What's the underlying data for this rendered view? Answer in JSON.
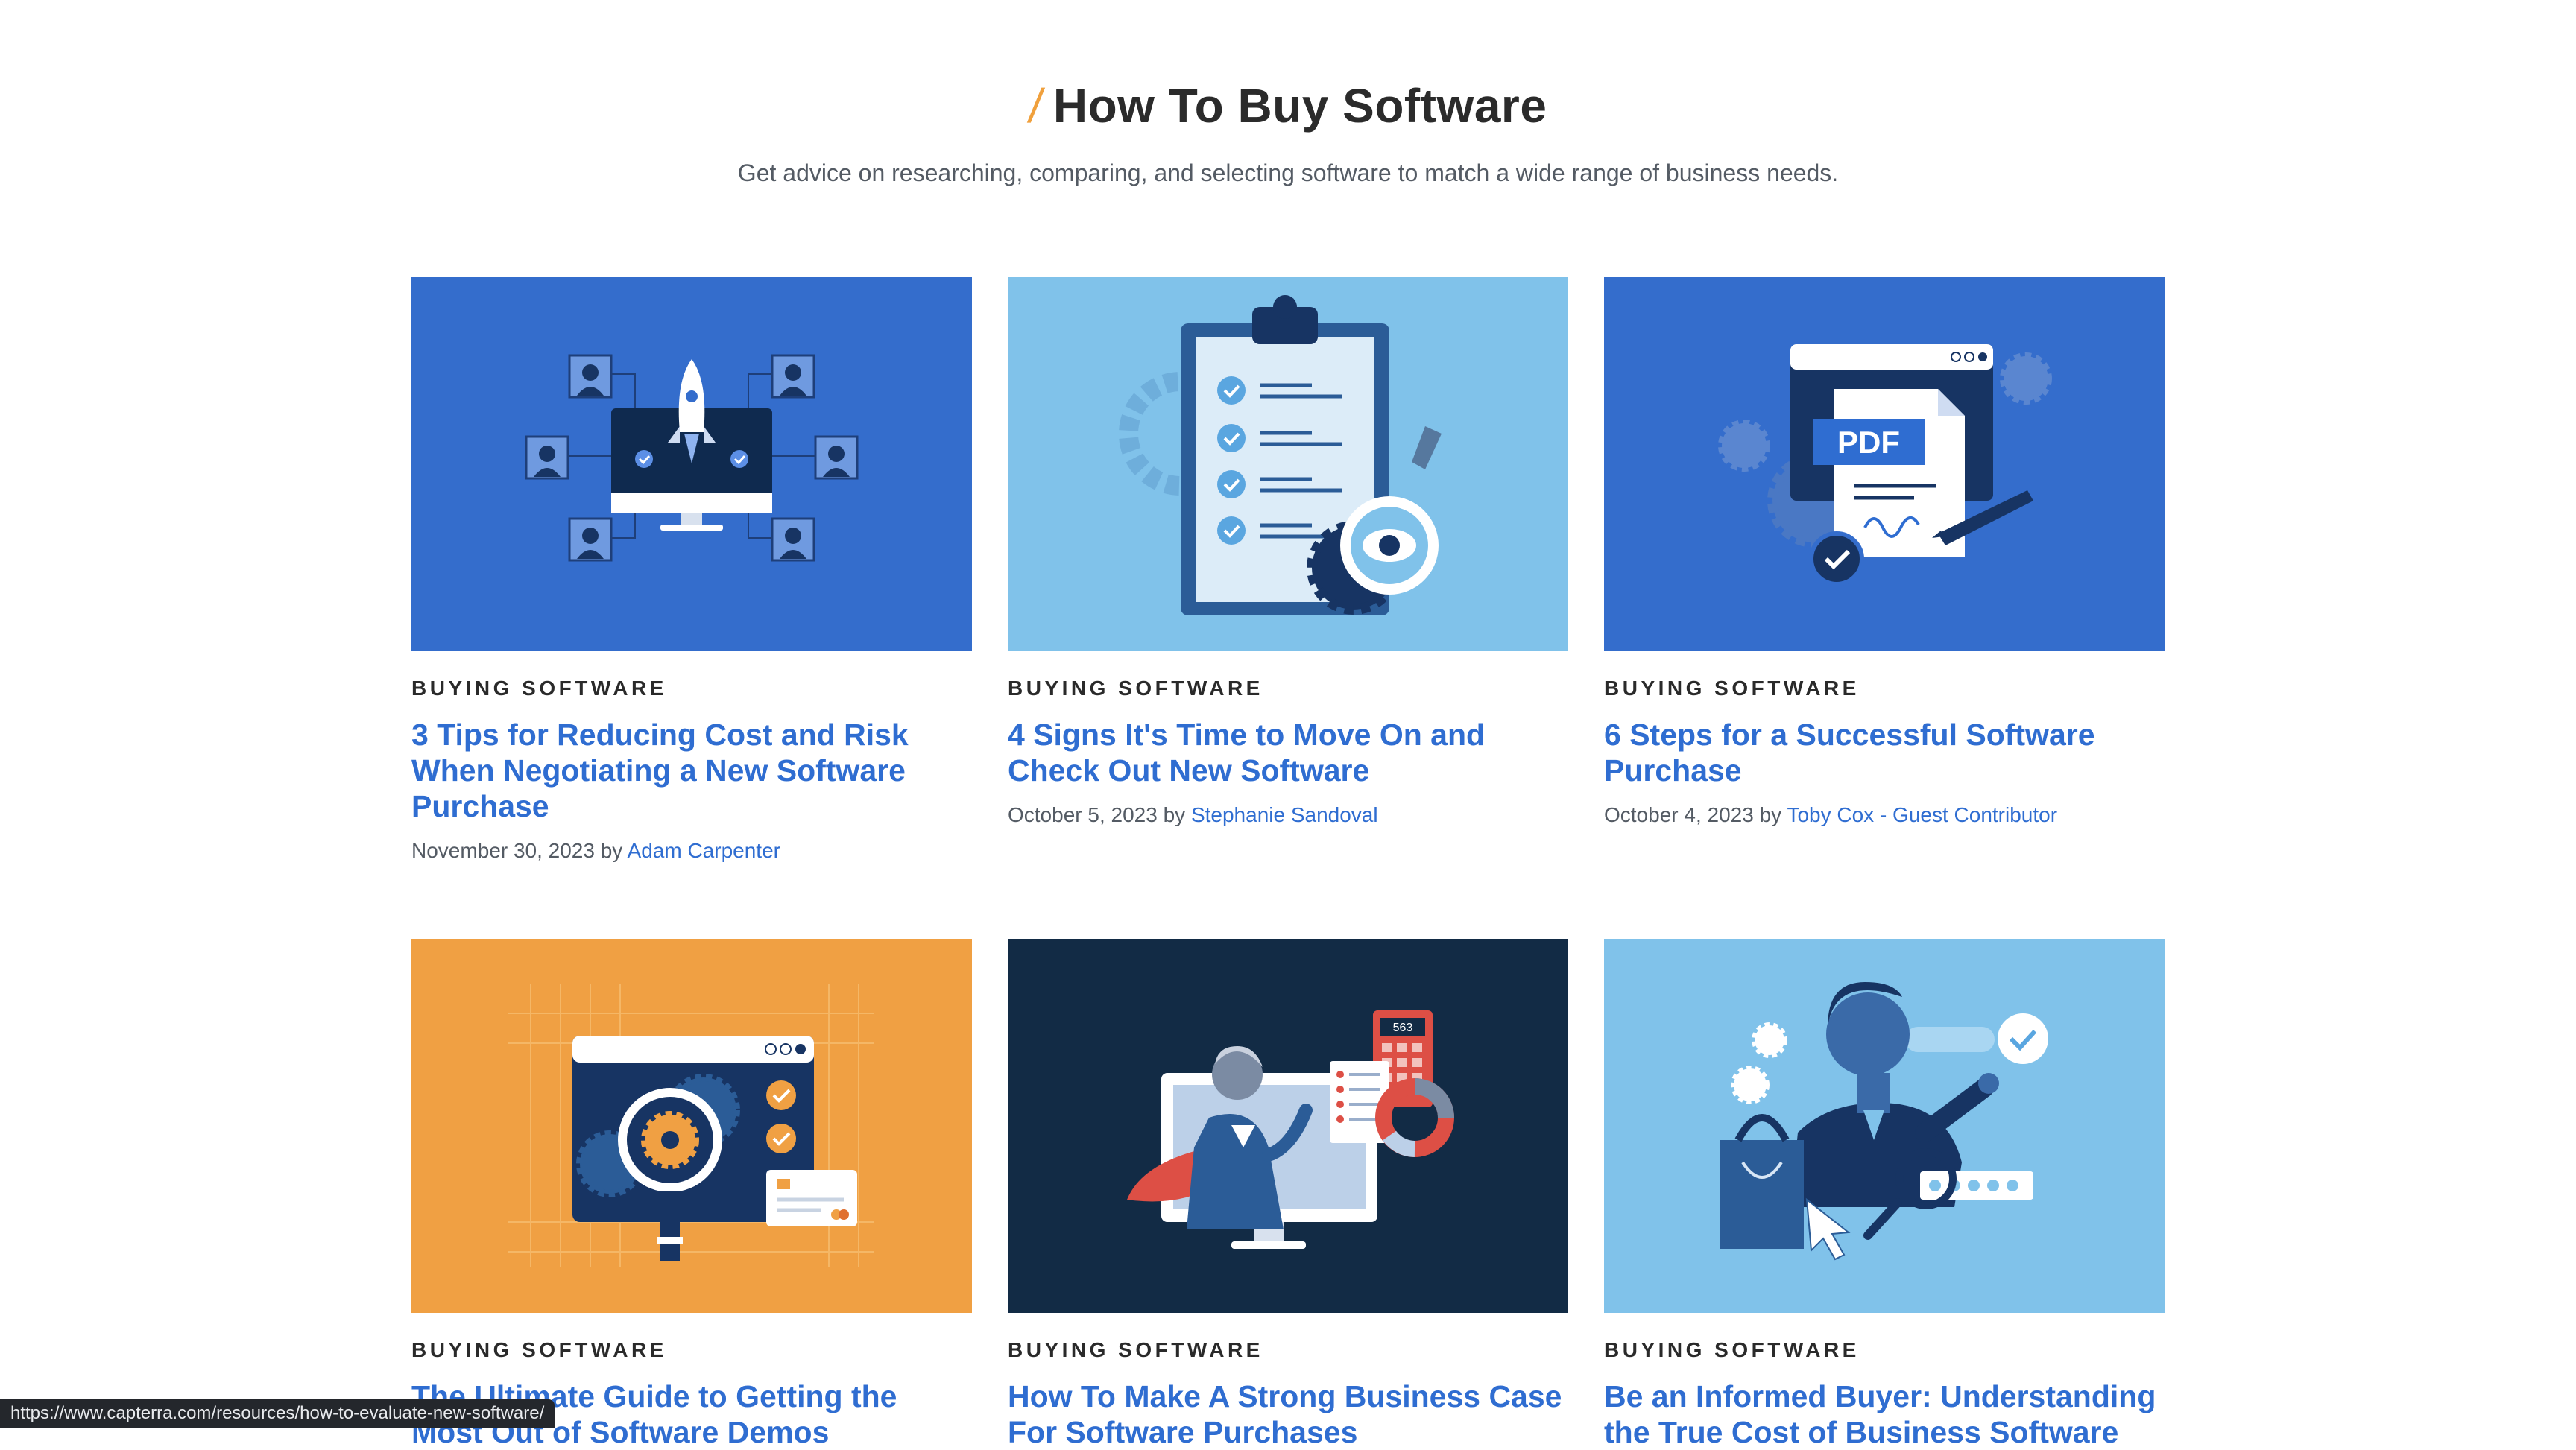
{
  "section": {
    "slash": "/",
    "title": "How To Buy Software",
    "subtitle": "Get advice on researching, comparing, and selecting software to match a wide range of business needs."
  },
  "articles": [
    {
      "category": "BUYING SOFTWARE",
      "title": "3 Tips for Reducing Cost and Risk When Negotiating a New Software Purchase",
      "date": "November 30, 2023",
      "by": "by",
      "author": "Adam Carpenter",
      "image_icon": "rocket-network-illustration",
      "bg": "#346dcc"
    },
    {
      "category": "BUYING SOFTWARE",
      "title": "4 Signs It's Time to Move On and Check Out New Software",
      "date": "October 5, 2023",
      "by": "by",
      "author": "Stephanie Sandoval",
      "image_icon": "clipboard-checklist-illustration",
      "bg": "#80c2ea"
    },
    {
      "category": "BUYING SOFTWARE",
      "title": "6 Steps for a Successful Software Purchase",
      "date": "October 4, 2023",
      "by": "by",
      "author": "Toby Cox - Guest Contributor",
      "image_icon": "pdf-contract-illustration",
      "bg": "#346dcc"
    },
    {
      "category": "BUYING SOFTWARE",
      "title": "The Ultimate Guide to Getting the Most Out of Software Demos",
      "image_icon": "software-demo-illustration",
      "bg": "#f0a043"
    },
    {
      "category": "BUYING SOFTWARE",
      "title": "How To Make A Strong Business Case For Software Purchases",
      "image_icon": "business-case-illustration",
      "bg": "#122b45"
    },
    {
      "category": "BUYING SOFTWARE",
      "title": "Be an Informed Buyer: Understanding the True Cost of Business Software",
      "image_icon": "informed-buyer-illustration",
      "bg": "#80c2ea"
    }
  ],
  "illustration_text": {
    "pdf_label": "PDF",
    "calc_value": "563"
  },
  "status_url": "https://www.capterra.com/resources/how-to-evaluate-new-software/"
}
